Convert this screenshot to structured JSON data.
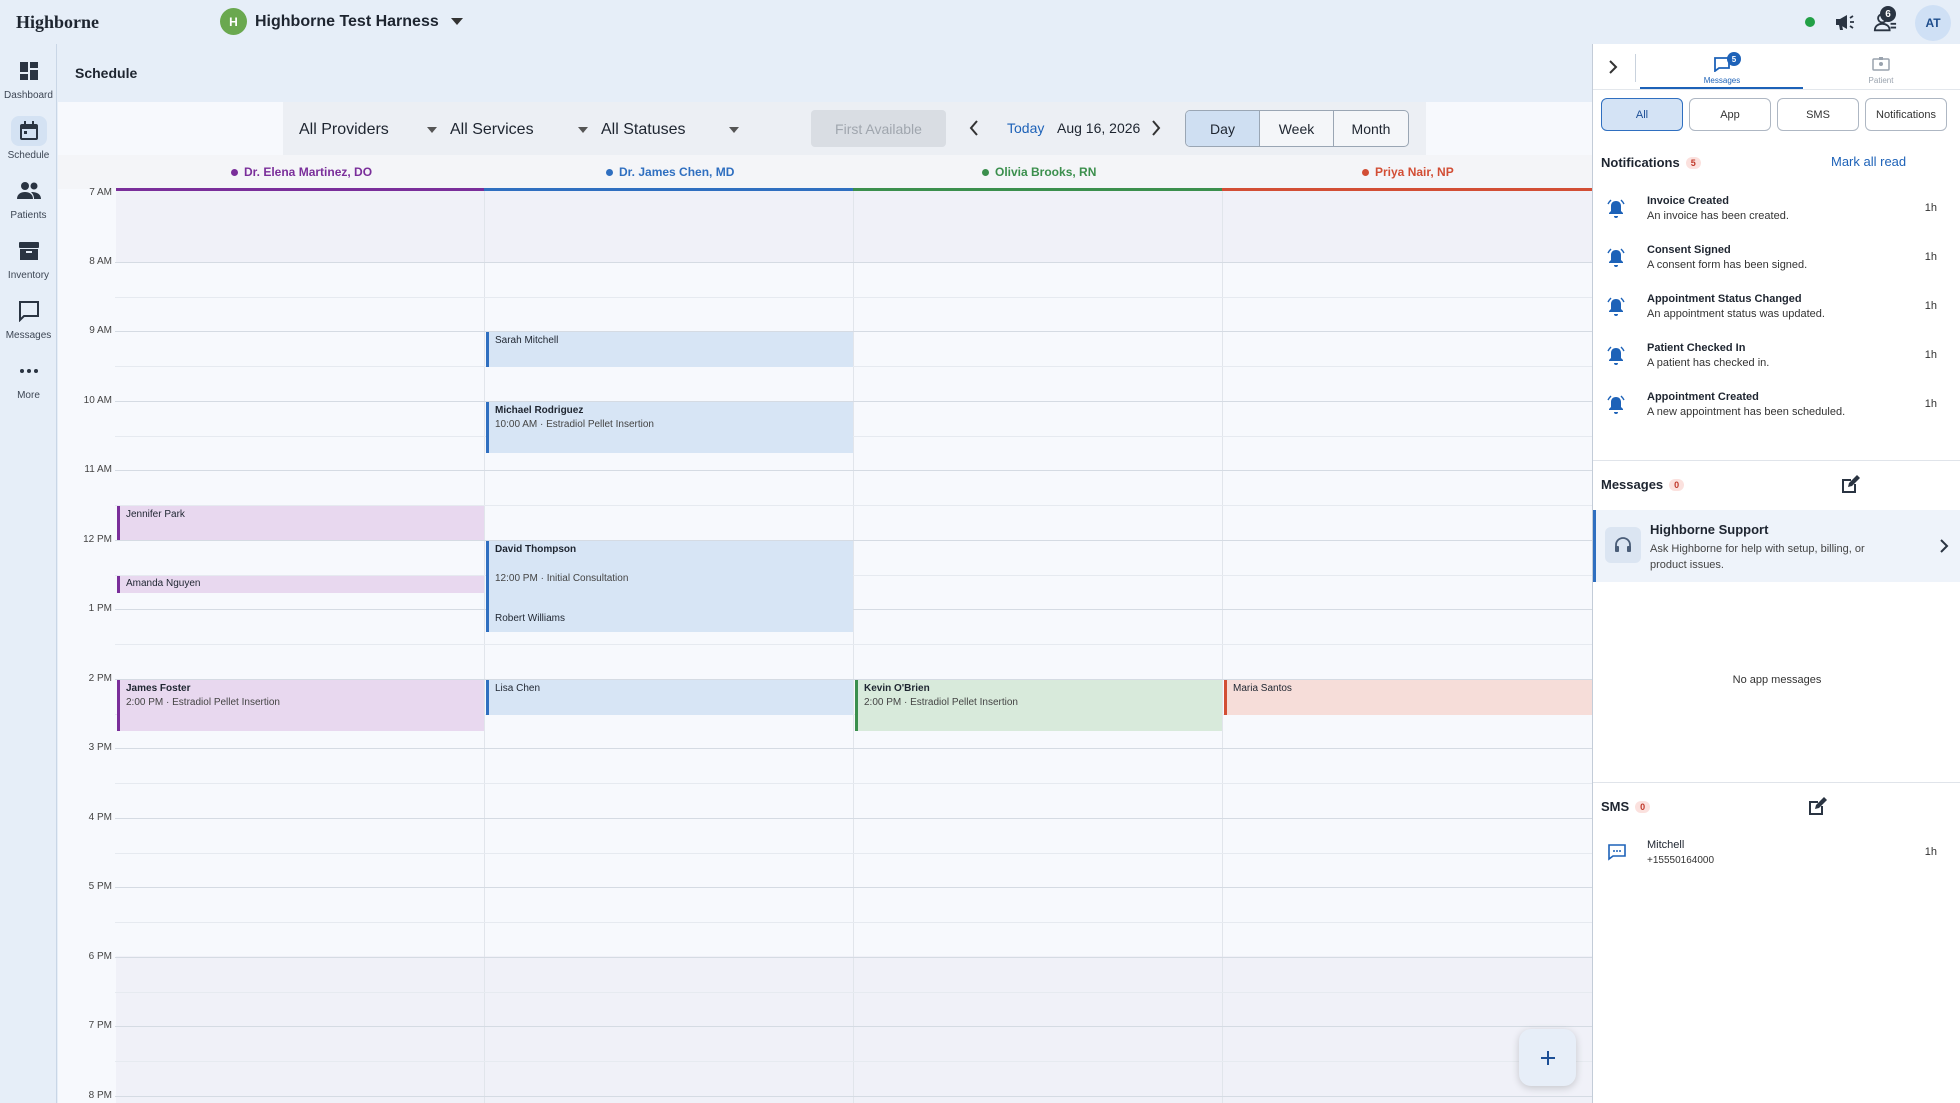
{
  "app": {
    "brand": "Highborne",
    "org_name": "Highborne Test Harness",
    "org_initial": "H",
    "user_initials": "AT",
    "team_badge": "6"
  },
  "nav": {
    "items": [
      {
        "label": "Dashboard",
        "icon": "dashboard-icon"
      },
      {
        "label": "Schedule",
        "icon": "calendar-icon"
      },
      {
        "label": "Patients",
        "icon": "people-icon"
      },
      {
        "label": "Inventory",
        "icon": "archive-icon"
      },
      {
        "label": "Messages",
        "icon": "chat-icon"
      },
      {
        "label": "More",
        "icon": "more-icon"
      }
    ],
    "active": "Schedule"
  },
  "page": {
    "title": "Schedule"
  },
  "toolbar": {
    "providers": "All Providers",
    "services": "All Services",
    "statuses": "All Statuses",
    "first_available": "First Available",
    "today": "Today",
    "date": "Aug 16, 2026",
    "views": [
      "Day",
      "Week",
      "Month"
    ],
    "active_view": "Day"
  },
  "providers": [
    {
      "name": "Dr. Elena Martinez, DO",
      "color": "#7a2e9a"
    },
    {
      "name": "Dr. James Chen, MD",
      "color": "#2f6fc0"
    },
    {
      "name": "Olivia Brooks, RN",
      "color": "#3b8f4d"
    },
    {
      "name": "Priya Nair, NP",
      "color": "#d24e35"
    }
  ],
  "hours": [
    "7 AM",
    "8 AM",
    "9 AM",
    "10 AM",
    "11 AM",
    "12 PM",
    "1 PM",
    "2 PM",
    "3 PM",
    "4 PM",
    "5 PM",
    "6 PM",
    "7 PM",
    "8 PM"
  ],
  "appointments": [
    {
      "provider": 1,
      "name": "Sarah Mitchell",
      "detail": ""
    },
    {
      "provider": 1,
      "name": "Michael Rodriguez",
      "detail": "10:00 AM · Estradiol Pellet Insertion"
    },
    {
      "provider": 0,
      "name": "Jennifer Park",
      "detail": ""
    },
    {
      "provider": 1,
      "name": "David Thompson",
      "detail": "12:00 PM · Initial Consultation"
    },
    {
      "provider": 0,
      "name": "Amanda Nguyen",
      "detail": ""
    },
    {
      "provider": 1,
      "name": "Robert Williams",
      "detail": ""
    },
    {
      "provider": 0,
      "name": "James Foster",
      "detail": "2:00 PM · Estradiol Pellet Insertion"
    },
    {
      "provider": 1,
      "name": "Lisa Chen",
      "detail": ""
    },
    {
      "provider": 2,
      "name": "Kevin O'Brien",
      "detail": "2:00 PM · Estradiol Pellet Insertion"
    },
    {
      "provider": 3,
      "name": "Maria Santos",
      "detail": ""
    }
  ],
  "panel": {
    "tabs": [
      {
        "label": "Messages",
        "badge": "5",
        "icon": "chat-bubble-icon"
      },
      {
        "label": "Patient",
        "icon": "id-card-icon"
      }
    ],
    "filters": [
      "All",
      "App",
      "SMS",
      "Notifications"
    ],
    "active_filter": "All",
    "notifications": {
      "title": "Notifications",
      "count": "5",
      "mark_all": "Mark all read",
      "items": [
        {
          "title": "Invoice Created",
          "desc": "An invoice has been created.",
          "time": "1h"
        },
        {
          "title": "Consent Signed",
          "desc": "A consent form has been signed.",
          "time": "1h"
        },
        {
          "title": "Appointment Status Changed",
          "desc": "An appointment status was updated.",
          "time": "1h"
        },
        {
          "title": "Patient Checked In",
          "desc": "A patient has checked in.",
          "time": "1h"
        },
        {
          "title": "Appointment Created",
          "desc": "A new appointment has been scheduled.",
          "time": "1h"
        }
      ]
    },
    "messages": {
      "title": "Messages",
      "count": "0",
      "support_title": "Highborne Support",
      "support_desc": "Ask Highborne for help with setup, billing, or product issues.",
      "empty": "No app messages"
    },
    "sms": {
      "title": "SMS",
      "count": "0",
      "items": [
        {
          "name": "Mitchell",
          "phone": "+15550164000",
          "time": "1h"
        }
      ]
    }
  }
}
